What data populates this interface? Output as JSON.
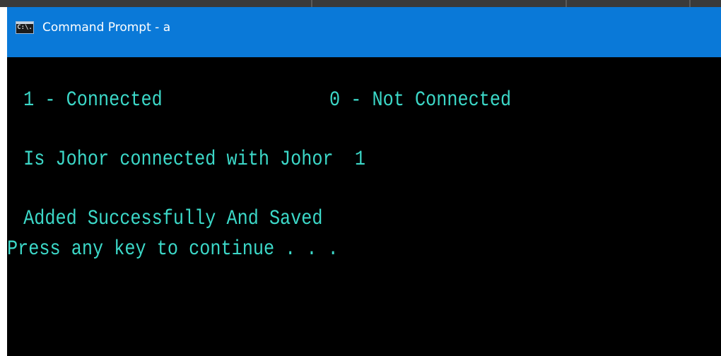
{
  "window": {
    "title": "Command Prompt - a",
    "icon": "cmd-console-icon",
    "icon_glyph": "C:\\.",
    "titlebar_color": "#0a79d8",
    "console_background": "#000000",
    "console_text_color": "#3cd8c8"
  },
  "console": {
    "legend_connected": " 1 - Connected",
    "legend_not_connected": "0 - Not Connected",
    "question_line": " Is Johor connected with Johor  1",
    "result_line": " Added Successfully And Saved",
    "prompt_line": "Press any key to continue . . ."
  }
}
